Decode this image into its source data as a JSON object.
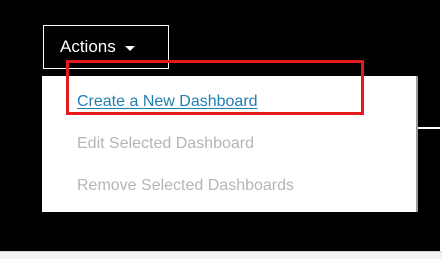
{
  "actions_menu": {
    "button_label": "Actions",
    "caret_icon": "caret-down-icon",
    "items": [
      {
        "label": "Create a New Dashboard",
        "state": "active"
      },
      {
        "label": "Edit Selected Dashboard",
        "state": "disabled"
      },
      {
        "label": "Remove Selected Dashboards",
        "state": "disabled"
      }
    ]
  },
  "annotation": {
    "highlight_color": "#e41a1c"
  },
  "colors": {
    "background": "#000000",
    "link": "#1e7fb0",
    "disabled": "#b5b5b5"
  }
}
